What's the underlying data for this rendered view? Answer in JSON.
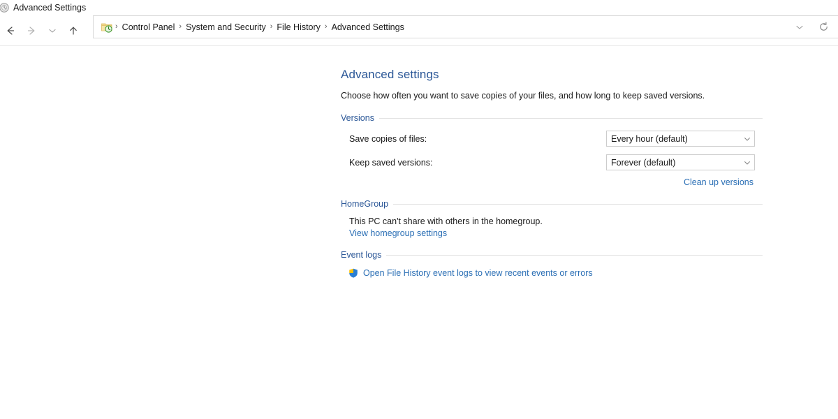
{
  "window": {
    "title": "Advanced Settings",
    "title_icon": "file-history-icon"
  },
  "toolbar": {
    "back_label": "Back",
    "forward_label": "Forward",
    "recent_label": "Recent locations",
    "up_label": "Up one level",
    "dropdown_label": "Previous locations",
    "refresh_label": "Refresh"
  },
  "address": {
    "icon": "file-history-folder-icon",
    "separator": "›",
    "crumbs": [
      {
        "label": "Control Panel"
      },
      {
        "label": "System and Security"
      },
      {
        "label": "File History"
      },
      {
        "label": "Advanced Settings"
      }
    ]
  },
  "page": {
    "title": "Advanced settings",
    "description": "Choose how often you want to save copies of your files, and how long to keep saved versions."
  },
  "sections": {
    "versions": {
      "title": "Versions",
      "rows": [
        {
          "label": "Save copies of files:",
          "value": "Every hour (default)"
        },
        {
          "label": "Keep saved versions:",
          "value": "Forever (default)"
        }
      ],
      "cleanup_link": "Clean up versions"
    },
    "homegroup": {
      "title": "HomeGroup",
      "text": "This PC can't share with others in the homegroup.",
      "link": "View homegroup settings"
    },
    "event_logs": {
      "title": "Event logs",
      "link": "Open File History event logs to view recent events or errors",
      "icon": "uac-shield-icon"
    }
  },
  "colors": {
    "heading": "#2b5797",
    "link": "#2b6fb5",
    "rule": "#e2e2e2",
    "border": "#d9d9d9"
  }
}
